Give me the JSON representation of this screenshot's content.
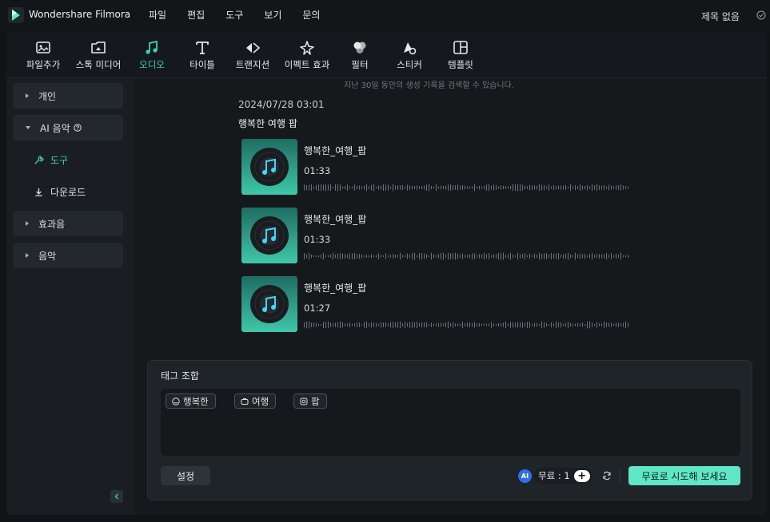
{
  "app": {
    "name": "Wondershare Filmora",
    "project_title": "제목 없음"
  },
  "menu": [
    "파일",
    "편집",
    "도구",
    "보기",
    "문의"
  ],
  "toolbar": [
    {
      "label": "파일추가",
      "icon": "import-icon"
    },
    {
      "label": "스톡 미디어",
      "icon": "stock-media-icon"
    },
    {
      "label": "오디오",
      "icon": "music-note-icon",
      "active": true
    },
    {
      "label": "타이틀",
      "icon": "title-t-icon"
    },
    {
      "label": "트랜지션",
      "icon": "transition-icon"
    },
    {
      "label": "이펙트 효과",
      "icon": "effects-icon"
    },
    {
      "label": "필터",
      "icon": "filter-icon"
    },
    {
      "label": "스티커",
      "icon": "sticker-icon"
    },
    {
      "label": "템플릿",
      "icon": "template-icon"
    }
  ],
  "sidebar": {
    "personal": "개인",
    "ai_music": "AI 음악",
    "tools": "도구",
    "download": "다운로드",
    "sound_effects": "효과음",
    "music": "음악"
  },
  "content": {
    "hint": "지난 30일 동안의 생성 기록을 검색할 수 있습니다.",
    "date": "2024/07/28 03:01",
    "title": "행복한 여행 팝",
    "tracks": [
      {
        "name": "행복한_여행_팝",
        "duration": "01:33"
      },
      {
        "name": "행복한_여행_팝",
        "duration": "01:33"
      },
      {
        "name": "행복한_여행_팝",
        "duration": "01:27"
      }
    ]
  },
  "tag_panel": {
    "title": "태그 조합",
    "tags": [
      "행복한",
      "여행",
      "팝"
    ],
    "settings_label": "설정",
    "ai_label": "AI",
    "credit_text": "무료 : 1",
    "plus_label": "+",
    "try_label": "무료로 시도해 보세요"
  },
  "colors": {
    "accent": "#37d4b2",
    "try_button": "#5fe6c7",
    "ai_badge": "#2f6fe8"
  }
}
